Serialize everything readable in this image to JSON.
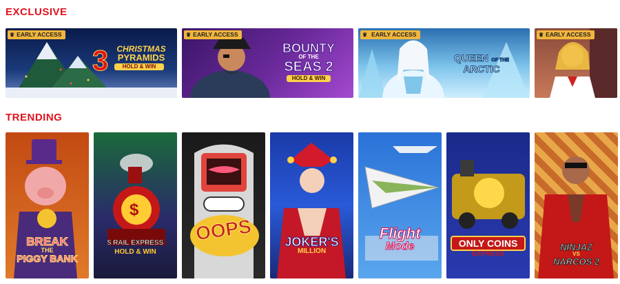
{
  "sections": {
    "exclusive": {
      "title": "EXCLUSIVE",
      "badge": "EARLY ACCESS",
      "games": [
        {
          "logo_line1": "3",
          "logo_line2": "CHRISTMAS",
          "logo_line3": "PYRAMIDS",
          "logo_line4": "HOLD & WIN",
          "icon": "christmas-pyramids-art"
        },
        {
          "logo_line1": "BOUNTY",
          "logo_line2": "OF THE",
          "logo_line3": "SEAS 2",
          "logo_line4": "HOLD & WIN",
          "icon": "pirate-art"
        },
        {
          "logo_line1": "QUEEN",
          "logo_line2": "OF THE",
          "logo_line3": "ARCTIC",
          "icon": "ice-queen-art"
        },
        {
          "icon": "lady-art"
        }
      ]
    },
    "trending": {
      "title": "TRENDING",
      "games": [
        {
          "logo_line1": "BREAK",
          "logo_line2": "THE",
          "logo_line3": "PIGGY BANK",
          "icon": "pig-art"
        },
        {
          "logo_line1": "$ RAIL EXPRESS",
          "logo_line2": "HOLD & WIN",
          "icon": "train-art"
        },
        {
          "logo_line1": "OOPS",
          "icon": "robot-art"
        },
        {
          "logo_line1": "JOKER'S",
          "logo_line2": "MILLION",
          "icon": "jester-art"
        },
        {
          "logo_line1": "Flight",
          "logo_line2": "Mode",
          "icon": "paper-plane-art"
        },
        {
          "logo_line1": "ONLY COINS",
          "logo_line2": "EXPRESS",
          "icon": "gold-train-art"
        },
        {
          "logo_line1": "NINJAZ",
          "logo_line2": "VS",
          "logo_line3": "NARCOS 2",
          "icon": "ninja-art"
        }
      ]
    }
  },
  "colors": {
    "accent": "#e0121b",
    "badge": "#f1b53c"
  }
}
